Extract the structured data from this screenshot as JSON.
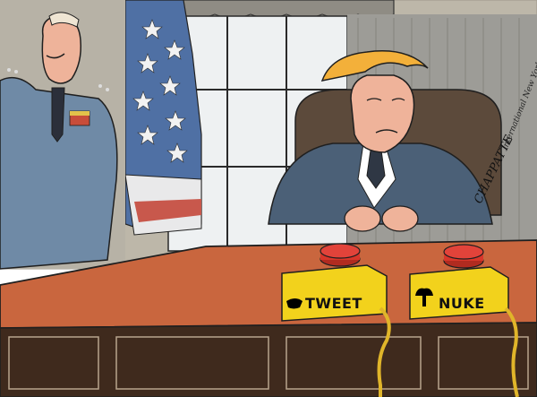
{
  "buttons": {
    "tweet": {
      "label": "TWEET",
      "icon": "bird-icon",
      "box_color": "#f2d21c",
      "knob_color": "#d8362a"
    },
    "nuke": {
      "label": "NUKE",
      "icon": "mushroom-cloud-icon",
      "box_color": "#f2d21c",
      "knob_color": "#d8362a"
    }
  },
  "credits": {
    "publication": "International New York Times",
    "artist_signature": "CHAPPATTE"
  },
  "colors": {
    "desk_top": "#c7653e",
    "desk_front": "#3f2a1d",
    "suit": "#4c6178",
    "uniform": "#6f8aa6",
    "wall": "#b9b3a6",
    "window_glass": "#e8ecef",
    "flag_blue": "#4d6fa2",
    "flag_red": "#c65b4f",
    "hair": "#f2b23c",
    "skin": "#f0b49a",
    "cord": "#e0b52a"
  }
}
